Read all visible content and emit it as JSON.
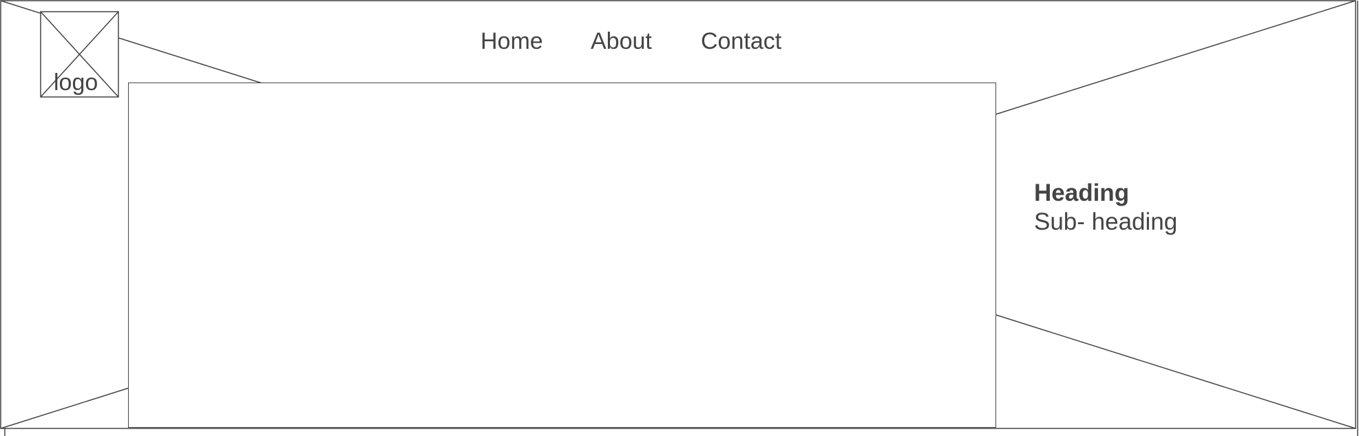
{
  "logo": {
    "label": "logo",
    "icon": "image-placeholder-icon"
  },
  "nav": {
    "items": [
      {
        "label": "Home"
      },
      {
        "label": "About"
      },
      {
        "label": "Contact"
      }
    ]
  },
  "hero": {
    "heading": "Heading",
    "subheading": "Sub- heading",
    "image": "image-placeholder"
  },
  "colors": {
    "stroke": "#444444",
    "background": "#ffffff"
  }
}
